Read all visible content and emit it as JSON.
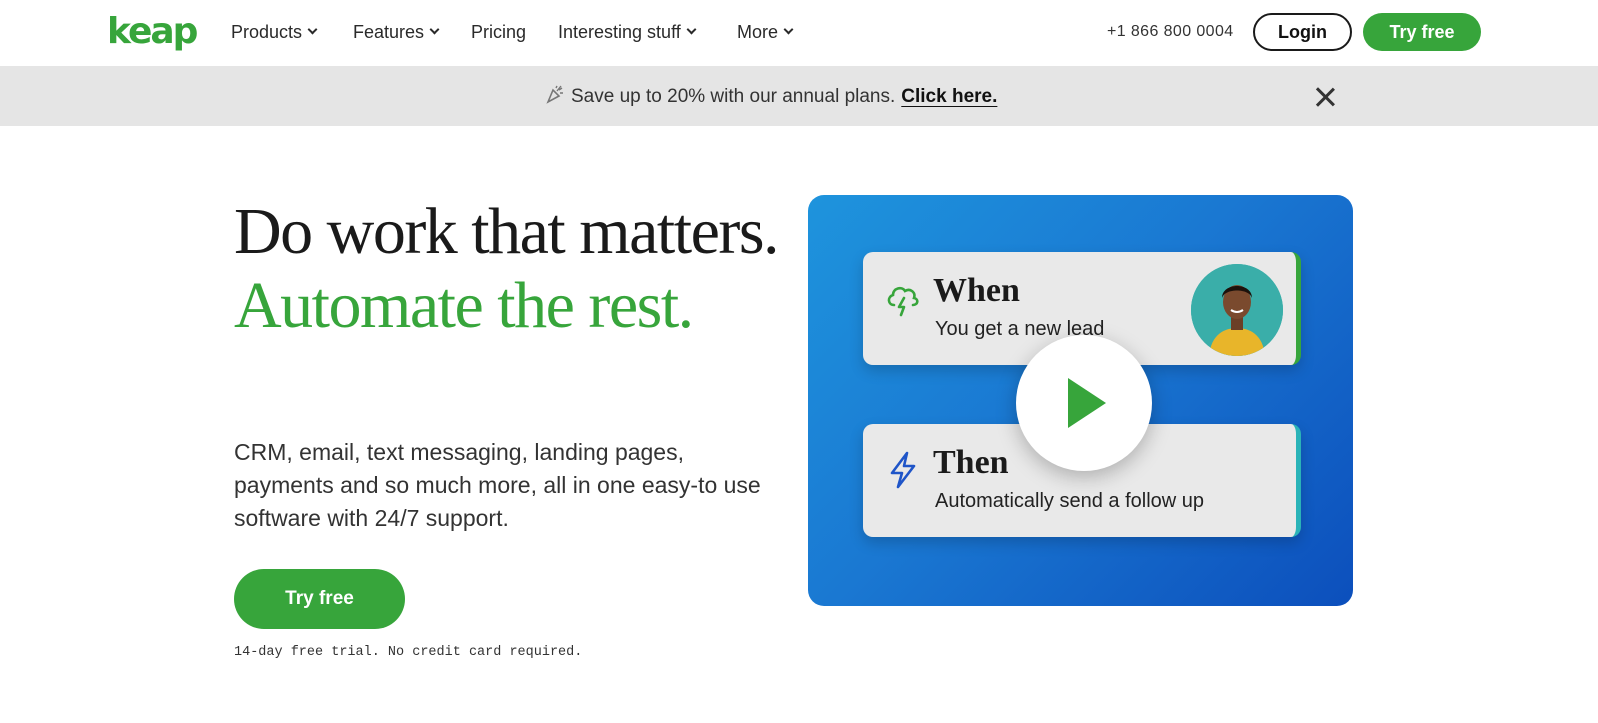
{
  "nav": {
    "logo": "keap",
    "items": [
      {
        "label": "Products",
        "has_dropdown": true
      },
      {
        "label": "Features",
        "has_dropdown": true
      },
      {
        "label": "Pricing",
        "has_dropdown": false
      },
      {
        "label": "Interesting stuff",
        "has_dropdown": true
      },
      {
        "label": "More",
        "has_dropdown": true
      }
    ],
    "phone": "+1 866 800 0004",
    "login_label": "Login",
    "try_free_label": "Try free"
  },
  "banner": {
    "icon": "party-popper-icon",
    "text": "Save up to 20% with our annual plans.",
    "link_label": "Click here."
  },
  "hero": {
    "headline_black": "Do work that matters.",
    "headline_green": "Automate the rest.",
    "subtext": "CRM, email, text messaging, landing pages, payments and so much more, all in one easy-to use software with 24/7 support.",
    "cta_label": "Try free",
    "trial_note": "14-day free trial. No credit card required."
  },
  "video": {
    "when_title": "When",
    "when_text": "You get a new lead",
    "then_title": "Then",
    "then_text": "Automatically send a follow up"
  },
  "colors": {
    "brand_green": "#37a53b",
    "banner_bg": "#e5e5e5",
    "video_blue": "#1a78d2"
  }
}
